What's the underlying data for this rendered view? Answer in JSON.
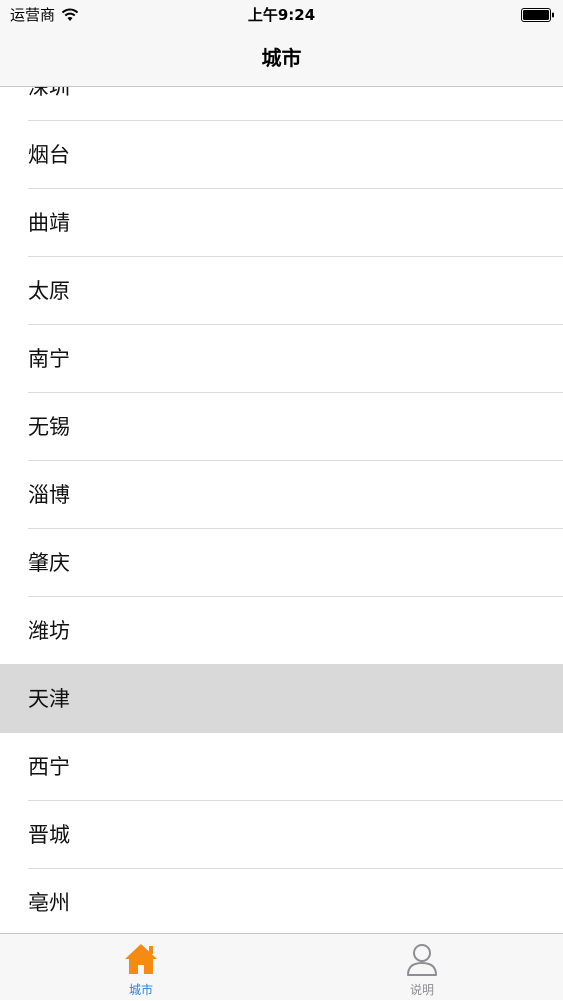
{
  "status_bar": {
    "carrier": "运营商",
    "time": "上午9:24",
    "icons": [
      "wifi-icon",
      "battery-icon"
    ]
  },
  "nav": {
    "title": "城市"
  },
  "cities": [
    {
      "label": "深圳"
    },
    {
      "label": "烟台"
    },
    {
      "label": "曲靖"
    },
    {
      "label": "太原"
    },
    {
      "label": "南宁"
    },
    {
      "label": "无锡"
    },
    {
      "label": "淄博"
    },
    {
      "label": "肇庆"
    },
    {
      "label": "潍坊"
    },
    {
      "label": "天津",
      "selected": true
    },
    {
      "label": "西宁"
    },
    {
      "label": "晋城"
    },
    {
      "label": "亳州"
    }
  ],
  "tab_bar": {
    "tabs": [
      {
        "label": "城市",
        "icon": "house-icon",
        "active": true,
        "color": "#f58b12"
      },
      {
        "label": "说明",
        "icon": "person-icon",
        "active": false,
        "color": "#8e8e93"
      }
    ],
    "active_label_color": "#2e7fd6"
  }
}
